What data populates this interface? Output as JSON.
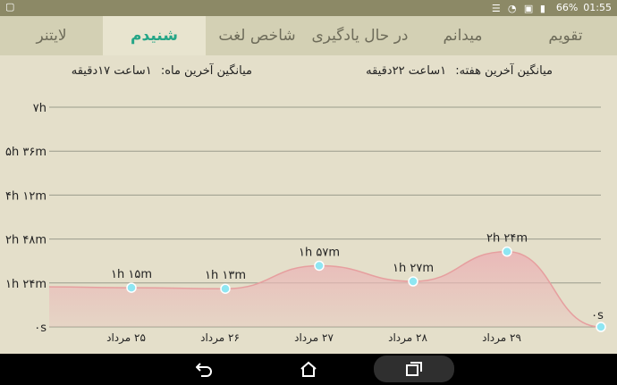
{
  "status_bar": {
    "battery": "66%",
    "time": "01:55"
  },
  "tabs": [
    {
      "label": "لایتنر",
      "active": false
    },
    {
      "label": "شنیدم",
      "active": true
    },
    {
      "label": "شاخص لغت",
      "active": false
    },
    {
      "label": "در حال یادگیری",
      "active": false
    },
    {
      "label": "میدانم",
      "active": false
    },
    {
      "label": "تقویم",
      "active": false
    }
  ],
  "averages": {
    "week_label": "میانگین آخرین هفته:",
    "week_value": "۱ساعت ۲۲دقیقه",
    "month_label": "میانگین آخرین ماه:",
    "month_value": "۱ساعت ۱۷دقیقه"
  },
  "colors": {
    "accent": "#25a687",
    "tab_bar": "#d3d0b4",
    "background": "#e4dfca",
    "area_fill": "#eab7b7",
    "line": "#e69f9f",
    "point": "#8ee6f2"
  },
  "chart_data": {
    "type": "area",
    "y_unit": "minutes",
    "ylim": [
      0,
      420
    ],
    "y_ticks": [
      {
        "label": "۰s",
        "value": 0
      },
      {
        "label": "۱h ۲۴m",
        "value": 84
      },
      {
        "label": "۲h ۴۸m",
        "value": 168
      },
      {
        "label": "۴h ۱۲m",
        "value": 252
      },
      {
        "label": "۵h ۳۶m",
        "value": 336
      },
      {
        "label": "۷h",
        "value": 420
      }
    ],
    "categories": [
      "۲۵ مرداد",
      "۲۶ مرداد",
      "۲۷ مرداد",
      "۲۸ مرداد",
      "۲۹ مرداد",
      ""
    ],
    "points": [
      {
        "x": "۲۵ مرداد",
        "value": 75,
        "label": "۱h ۱۵m"
      },
      {
        "x": "۲۶ مرداد",
        "value": 73,
        "label": "۱h ۱۳m"
      },
      {
        "x": "۲۷ مرداد",
        "value": 117,
        "label": "۱h ۵۷m"
      },
      {
        "x": "۲۸ مرداد",
        "value": 87,
        "label": "۱h ۲۷m"
      },
      {
        "x": "۲۹ مرداد",
        "value": 144,
        "label": "۲h ۲۴m"
      },
      {
        "x": "",
        "value": 0,
        "label": "۰s"
      }
    ],
    "grid": true
  }
}
